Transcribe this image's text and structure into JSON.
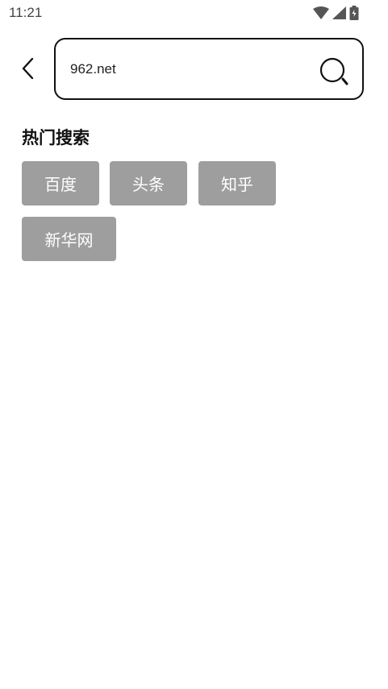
{
  "status_bar": {
    "time": "11:21",
    "icons": [
      "wifi-icon",
      "cellular-signal-icon",
      "battery-icon"
    ]
  },
  "search": {
    "value": "962.net",
    "back_icon": "chevron-left-icon",
    "search_icon": "search-icon"
  },
  "hot_search": {
    "title": "热门搜索",
    "tags": [
      {
        "label": "百度"
      },
      {
        "label": "头条"
      },
      {
        "label": "知乎"
      },
      {
        "label": "新华网"
      }
    ]
  },
  "colors": {
    "tag_background": "#9e9e9e",
    "tag_text": "#ffffff",
    "border": "#111111",
    "background": "#ffffff"
  }
}
